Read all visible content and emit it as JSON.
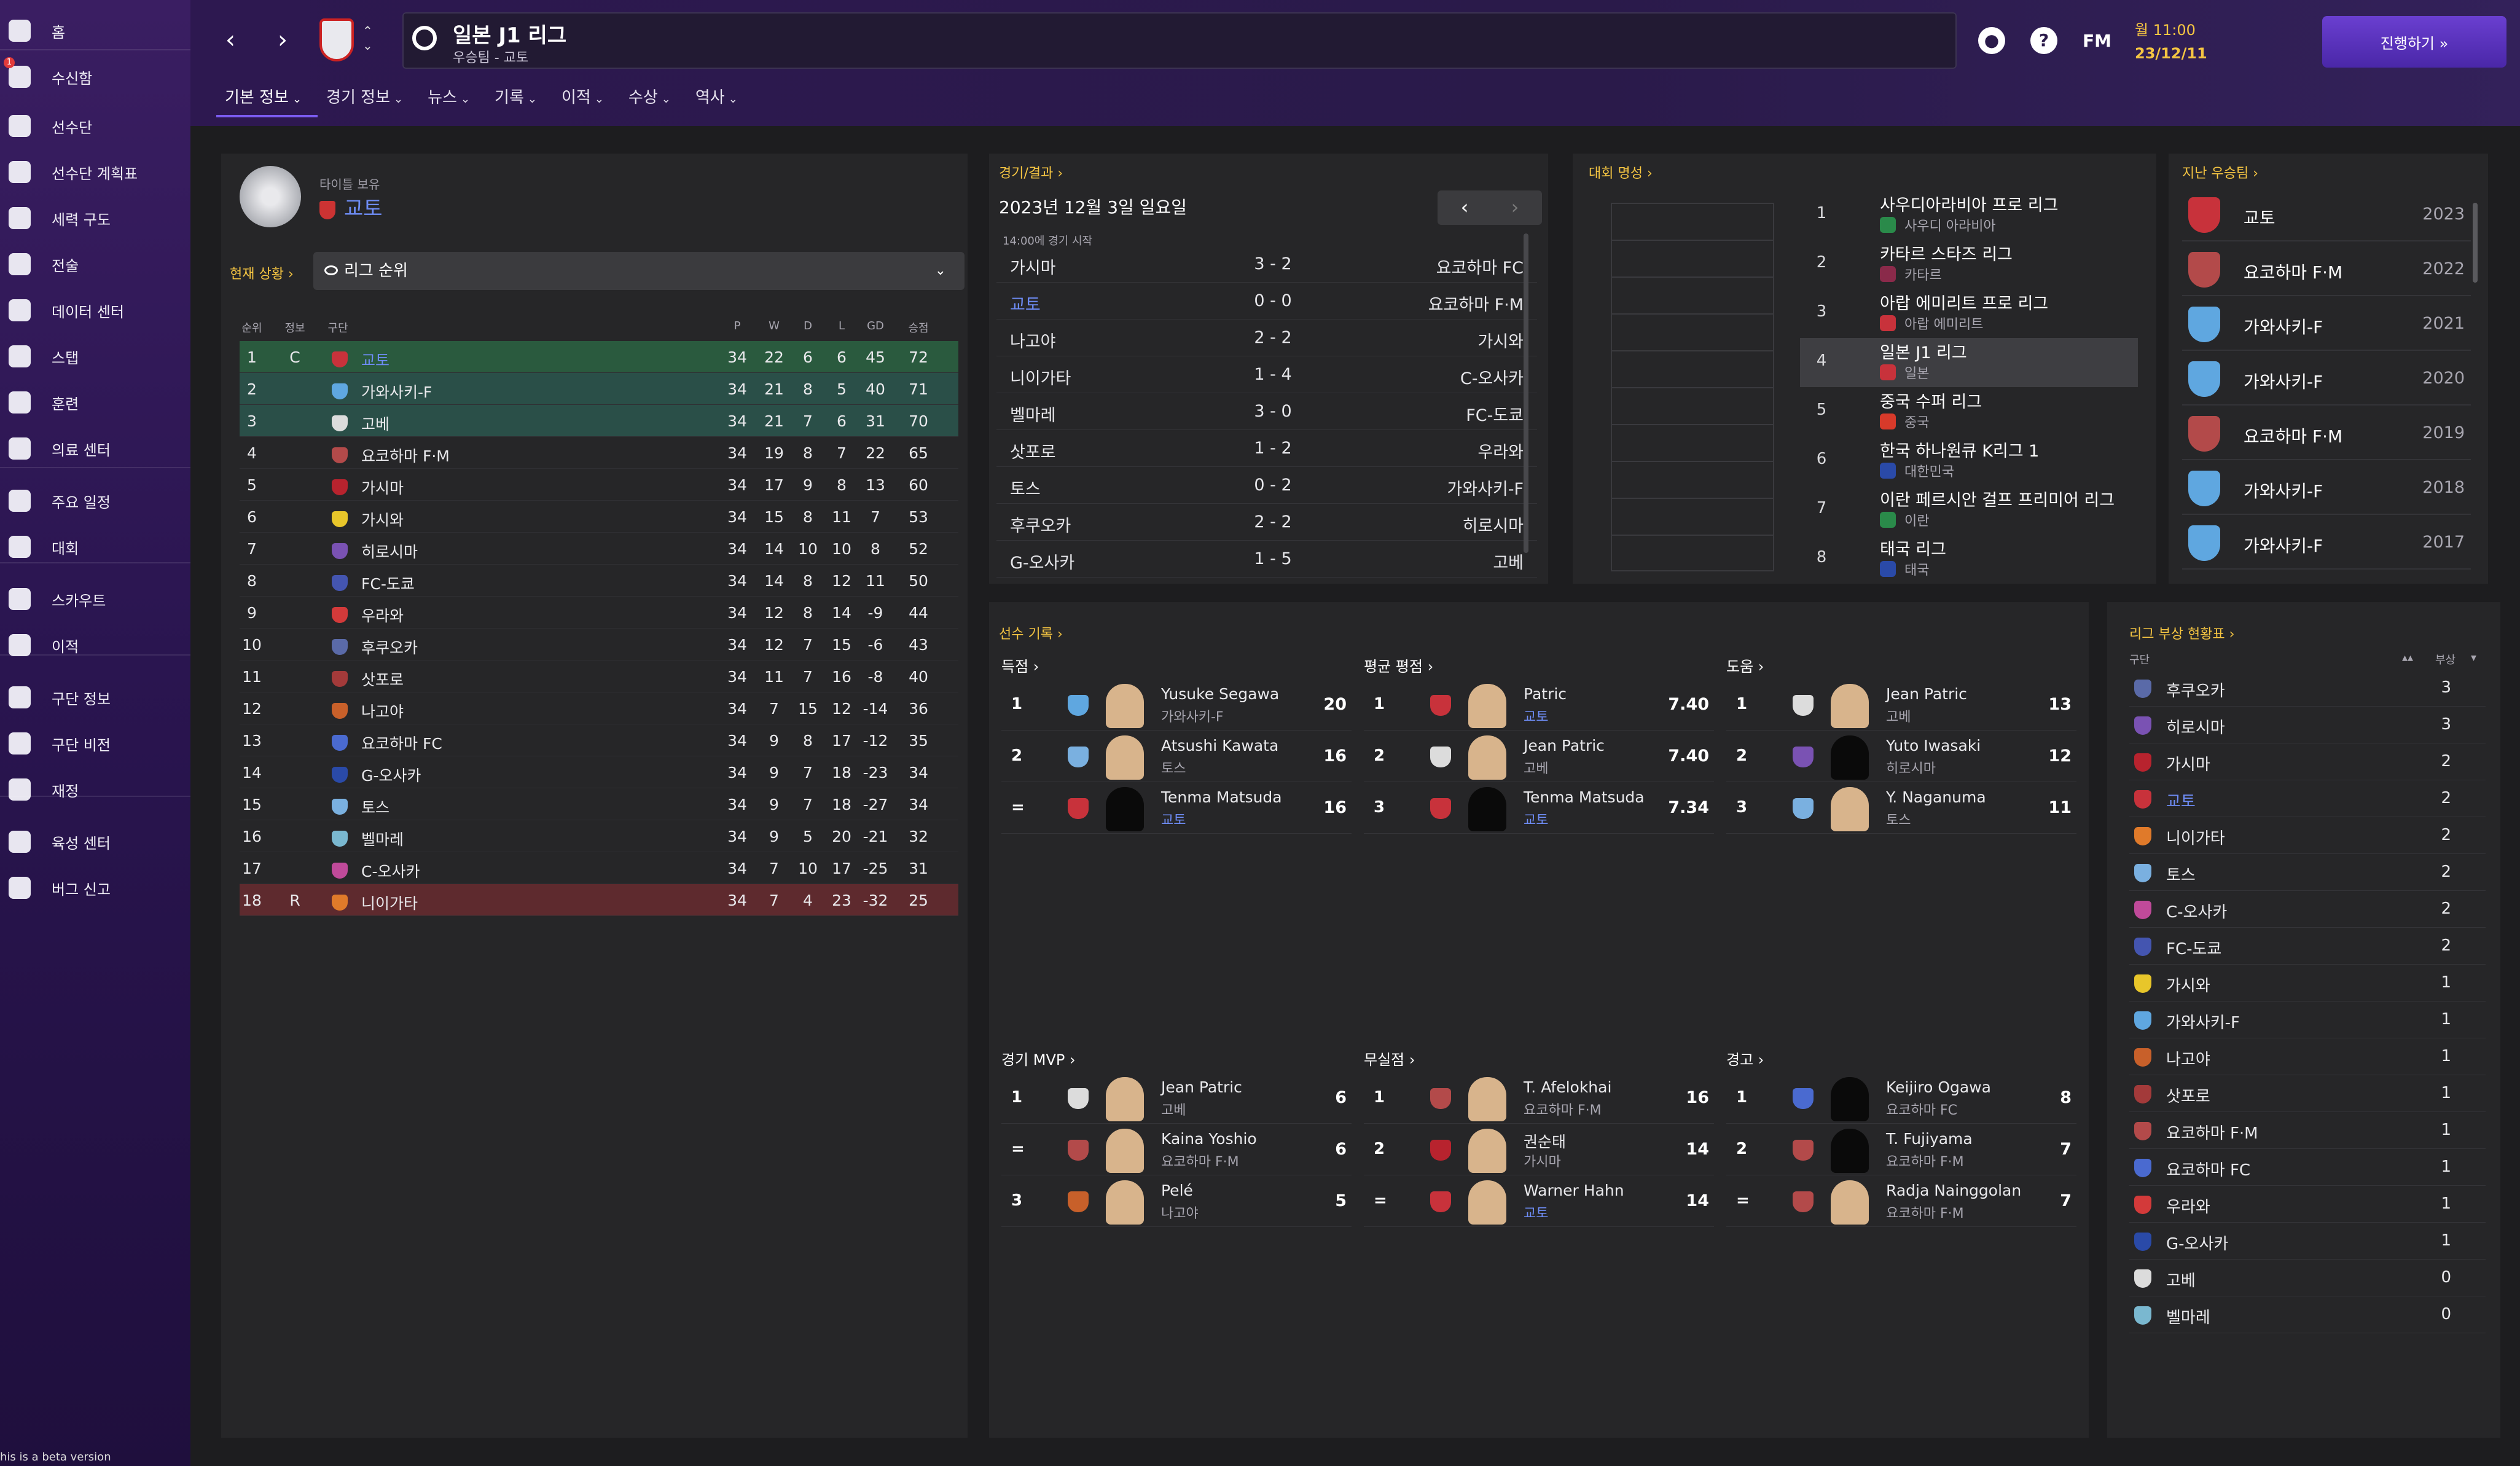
{
  "sidebar": {
    "items": [
      {
        "label": "홈",
        "icon": "home-icon"
      },
      {
        "label": "수신함",
        "icon": "inbox-icon",
        "badge": "1"
      },
      {
        "label": "선수단",
        "icon": "squad-icon"
      },
      {
        "label": "선수단 계획표",
        "icon": "squad-planner-icon"
      },
      {
        "label": "세력 구도",
        "icon": "dynamics-icon"
      },
      {
        "label": "전술",
        "icon": "tactics-icon"
      },
      {
        "label": "데이터 센터",
        "icon": "data-hub-icon"
      },
      {
        "label": "스탭",
        "icon": "staff-icon"
      },
      {
        "label": "훈련",
        "icon": "training-icon"
      },
      {
        "label": "의료 센터",
        "icon": "medical-icon"
      },
      {
        "label": "주요 일정",
        "icon": "calendar-icon"
      },
      {
        "label": "대회",
        "icon": "trophy-icon"
      },
      {
        "label": "스카우트",
        "icon": "scouting-icon"
      },
      {
        "label": "이적",
        "icon": "transfers-icon"
      },
      {
        "label": "구단 정보",
        "icon": "club-info-icon"
      },
      {
        "label": "구단 비전",
        "icon": "club-vision-icon"
      },
      {
        "label": "재정",
        "icon": "finances-icon"
      },
      {
        "label": "육성 센터",
        "icon": "development-icon"
      },
      {
        "label": "버그 신고",
        "icon": "bug-report-icon"
      }
    ],
    "beta_note": "his is a beta version"
  },
  "header": {
    "title": "일본 J1 리그",
    "subtitle": "우승팀 - 교토",
    "fm_label": "FM",
    "help_label": "?",
    "date_line1": "월 11:00",
    "date_line2": "23/12/11",
    "continue_label": "진행하기 »",
    "tabs": [
      {
        "label": "기본 정보"
      },
      {
        "label": "경기 정보"
      },
      {
        "label": "뉴스"
      },
      {
        "label": "기록"
      },
      {
        "label": "이적"
      },
      {
        "label": "수상"
      },
      {
        "label": "역사"
      }
    ]
  },
  "league_table": {
    "title_holder_label": "타이틀 보유",
    "title_holder_club": "교토",
    "status_label": "현재 상황 ›",
    "status_select": "리그 순위",
    "headers": {
      "pos": "순위",
      "info": "정보",
      "club": "구단",
      "p": "P",
      "w": "W",
      "d": "D",
      "l": "L",
      "gd": "GD",
      "pts": "승점"
    },
    "rows": [
      {
        "pos": "1",
        "info": "C",
        "club": "교토",
        "p": "34",
        "w": "22",
        "d": "6",
        "l": "6",
        "gd": "45",
        "pts": "72",
        "color": "#c8323b"
      },
      {
        "pos": "2",
        "info": "",
        "club": "가와사키-F",
        "p": "34",
        "w": "21",
        "d": "8",
        "l": "5",
        "gd": "40",
        "pts": "71",
        "color": "#5fa7e0"
      },
      {
        "pos": "3",
        "info": "",
        "club": "고베",
        "p": "34",
        "w": "21",
        "d": "7",
        "l": "6",
        "gd": "31",
        "pts": "70",
        "color": "#dcdcdc"
      },
      {
        "pos": "4",
        "info": "",
        "club": "요코하마 F·M",
        "p": "34",
        "w": "19",
        "d": "8",
        "l": "7",
        "gd": "22",
        "pts": "65",
        "color": "#b34a4a"
      },
      {
        "pos": "5",
        "info": "",
        "club": "가시마",
        "p": "34",
        "w": "17",
        "d": "9",
        "l": "8",
        "gd": "13",
        "pts": "60",
        "color": "#b8232e"
      },
      {
        "pos": "6",
        "info": "",
        "club": "가시와",
        "p": "34",
        "w": "15",
        "d": "8",
        "l": "11",
        "gd": "7",
        "pts": "53",
        "color": "#e8c62a"
      },
      {
        "pos": "7",
        "info": "",
        "club": "히로시마",
        "p": "34",
        "w": "14",
        "d": "10",
        "l": "10",
        "gd": "8",
        "pts": "52",
        "color": "#7a52b3"
      },
      {
        "pos": "8",
        "info": "",
        "club": "FC-도쿄",
        "p": "34",
        "w": "14",
        "d": "8",
        "l": "12",
        "gd": "11",
        "pts": "50",
        "color": "#4455b0"
      },
      {
        "pos": "9",
        "info": "",
        "club": "우라와",
        "p": "34",
        "w": "12",
        "d": "8",
        "l": "14",
        "gd": "-9",
        "pts": "44",
        "color": "#d33a3a"
      },
      {
        "pos": "10",
        "info": "",
        "club": "후쿠오카",
        "p": "34",
        "w": "12",
        "d": "7",
        "l": "15",
        "gd": "-6",
        "pts": "43",
        "color": "#5a6aa8"
      },
      {
        "pos": "11",
        "info": "",
        "club": "삿포로",
        "p": "34",
        "w": "11",
        "d": "7",
        "l": "16",
        "gd": "-8",
        "pts": "40",
        "color": "#a33a3a"
      },
      {
        "pos": "12",
        "info": "",
        "club": "나고야",
        "p": "34",
        "w": "7",
        "d": "15",
        "l": "12",
        "gd": "-14",
        "pts": "36",
        "color": "#c8602a"
      },
      {
        "pos": "13",
        "info": "",
        "club": "요코하마 FC",
        "p": "34",
        "w": "9",
        "d": "8",
        "l": "17",
        "gd": "-12",
        "pts": "35",
        "color": "#4a6ad0"
      },
      {
        "pos": "14",
        "info": "",
        "club": "G-오사카",
        "p": "34",
        "w": "9",
        "d": "7",
        "l": "18",
        "gd": "-23",
        "pts": "34",
        "color": "#2a4aa8"
      },
      {
        "pos": "15",
        "info": "",
        "club": "토스",
        "p": "34",
        "w": "9",
        "d": "7",
        "l": "18",
        "gd": "-27",
        "pts": "34",
        "color": "#7ab0e0"
      },
      {
        "pos": "16",
        "info": "",
        "club": "벨마레",
        "p": "34",
        "w": "9",
        "d": "5",
        "l": "20",
        "gd": "-21",
        "pts": "32",
        "color": "#7ab8d0"
      },
      {
        "pos": "17",
        "info": "",
        "club": "C-오사카",
        "p": "34",
        "w": "7",
        "d": "10",
        "l": "17",
        "gd": "-25",
        "pts": "31",
        "color": "#c04a9a"
      },
      {
        "pos": "18",
        "info": "R",
        "club": "니이가타",
        "p": "34",
        "w": "7",
        "d": "4",
        "l": "23",
        "gd": "-32",
        "pts": "25",
        "color": "#e07a2a"
      }
    ]
  },
  "fixtures": {
    "title": "경기/결과 ›",
    "date": "2023년 12월 3일 일요일",
    "kickoff": "14:00에 경기 시작",
    "prev": "‹",
    "next": "›",
    "rows": [
      {
        "home": "가시마",
        "score": "3 - 2",
        "away": "요코하마 FC"
      },
      {
        "home": "교토",
        "score": "0 - 0",
        "away": "요코하마 F·M",
        "home_link": true
      },
      {
        "home": "나고야",
        "score": "2 - 2",
        "away": "가시와"
      },
      {
        "home": "니이가타",
        "score": "1 - 4",
        "away": "C-오사카"
      },
      {
        "home": "벨마레",
        "score": "3 - 0",
        "away": "FC-도쿄"
      },
      {
        "home": "삿포로",
        "score": "1 - 2",
        "away": "우라와"
      },
      {
        "home": "토스",
        "score": "0 - 2",
        "away": "가와사키-F"
      },
      {
        "home": "후쿠오카",
        "score": "2 - 2",
        "away": "히로시마"
      },
      {
        "home": "G-오사카",
        "score": "1 - 5",
        "away": "고베"
      }
    ]
  },
  "reputation": {
    "title": "대회 명성 ›",
    "rows": [
      {
        "rank": "1",
        "name": "사우디아라비아 프로 리그",
        "country": "사우디 아라비아",
        "color": "#2a8a4a"
      },
      {
        "rank": "2",
        "name": "카타르 스타즈 리그",
        "country": "카타르",
        "color": "#8a2a4a"
      },
      {
        "rank": "3",
        "name": "아랍 에미리트 프로 리그",
        "country": "아랍 에미리트",
        "color": "#c8323b"
      },
      {
        "rank": "4",
        "name": "일본 J1 리그",
        "country": "일본",
        "color": "#c8323b",
        "selected": true
      },
      {
        "rank": "5",
        "name": "중국 수퍼 리그",
        "country": "중국",
        "color": "#d83a2a"
      },
      {
        "rank": "6",
        "name": "한국 하나원큐 K리그 1",
        "country": "대한민국",
        "color": "#2a4aa8"
      },
      {
        "rank": "7",
        "name": "이란 페르시안 걸프 프리미어 리그",
        "country": "이란",
        "color": "#2a8a4a"
      },
      {
        "rank": "8",
        "name": "태국 리그",
        "country": "태국",
        "color": "#2a4aa8"
      }
    ]
  },
  "past_winners": {
    "title": "지난 우승팀 ›",
    "rows": [
      {
        "club": "교토",
        "year": "2023",
        "color": "#c8323b"
      },
      {
        "club": "요코하마 F·M",
        "year": "2022",
        "color": "#b34a4a"
      },
      {
        "club": "가와사키-F",
        "year": "2021",
        "color": "#5fa7e0"
      },
      {
        "club": "가와사키-F",
        "year": "2020",
        "color": "#5fa7e0"
      },
      {
        "club": "요코하마 F·M",
        "year": "2019",
        "color": "#b34a4a"
      },
      {
        "club": "가와사키-F",
        "year": "2018",
        "color": "#5fa7e0"
      },
      {
        "club": "가와사키-F",
        "year": "2017",
        "color": "#5fa7e0"
      }
    ]
  },
  "player_stats": {
    "title": "선수 기록 ›",
    "goals": {
      "title": "득점   ›",
      "rows": [
        {
          "rank": "1",
          "name": "Yusuke Segawa",
          "club": "가와사키-F",
          "value": "20",
          "crest": "#5fa7e0",
          "sil": false
        },
        {
          "rank": "2",
          "name": "Atsushi Kawata",
          "club": "토스",
          "value": "16",
          "crest": "#7ab0e0",
          "sil": false
        },
        {
          "rank": "=",
          "name": "Tenma Matsuda",
          "club": "교토",
          "value": "16",
          "crest": "#c8323b",
          "sil": true,
          "link": true
        }
      ]
    },
    "rating": {
      "title": "평균 평점 ›",
      "rows": [
        {
          "rank": "1",
          "name": "Patric",
          "club": "교토",
          "value": "7.40",
          "crest": "#c8323b",
          "sil": false,
          "link": true
        },
        {
          "rank": "2",
          "name": "Jean Patric",
          "club": "고베",
          "value": "7.40",
          "crest": "#dcdcdc",
          "sil": false
        },
        {
          "rank": "3",
          "name": "Tenma Matsuda",
          "club": "교토",
          "value": "7.34",
          "crest": "#c8323b",
          "sil": true,
          "link": true
        }
      ]
    },
    "assists": {
      "title": "도움   ›",
      "rows": [
        {
          "rank": "1",
          "name": "Jean Patric",
          "club": "고베",
          "value": "13",
          "crest": "#dcdcdc",
          "sil": false
        },
        {
          "rank": "2",
          "name": "Yuto Iwasaki",
          "club": "히로시마",
          "value": "12",
          "crest": "#7a52b3",
          "sil": true
        },
        {
          "rank": "3",
          "name": "Y. Naganuma",
          "club": "토스",
          "value": "11",
          "crest": "#7ab0e0",
          "sil": false
        }
      ]
    },
    "mvp": {
      "title": "경기 MVP ›",
      "rows": [
        {
          "rank": "1",
          "name": "Jean Patric",
          "club": "고베",
          "value": "6",
          "crest": "#dcdcdc",
          "sil": false
        },
        {
          "rank": "=",
          "name": "Kaina Yoshio",
          "club": "요코하마 F·M",
          "value": "6",
          "crest": "#b34a4a",
          "sil": false
        },
        {
          "rank": "3",
          "name": "Pelé",
          "club": "나고야",
          "value": "5",
          "crest": "#c8602a",
          "sil": false
        }
      ]
    },
    "clean_sheets": {
      "title": "무실점 ›",
      "rows": [
        {
          "rank": "1",
          "name": "T. Afelokhai",
          "club": "요코하마 F·M",
          "value": "16",
          "crest": "#b34a4a",
          "sil": false
        },
        {
          "rank": "2",
          "name": "권순태",
          "club": "가시마",
          "value": "14",
          "crest": "#b8232e",
          "sil": false
        },
        {
          "rank": "=",
          "name": "Warner Hahn",
          "club": "교토",
          "value": "14",
          "crest": "#c8323b",
          "sil": false,
          "link": true
        }
      ]
    },
    "cards": {
      "title": "경고   ›",
      "rows": [
        {
          "rank": "1",
          "name": "Keijiro Ogawa",
          "club": "요코하마 FC",
          "value": "8",
          "crest": "#4a6ad0",
          "sil": true
        },
        {
          "rank": "2",
          "name": "T. Fujiyama",
          "club": "요코하마 F·M",
          "value": "7",
          "crest": "#b34a4a",
          "sil": true
        },
        {
          "rank": "=",
          "name": "Radja Nainggolan",
          "club": "요코하마 F·M",
          "value": "7",
          "crest": "#b34a4a",
          "sil": false
        }
      ]
    }
  },
  "injuries": {
    "title": "리그 부상 현황표 ›",
    "col_club": "구단",
    "col_count": "부상",
    "rows": [
      {
        "club": "후쿠오카",
        "value": "3",
        "color": "#5a6aa8"
      },
      {
        "club": "히로시마",
        "value": "3",
        "color": "#7a52b3"
      },
      {
        "club": "가시마",
        "value": "2",
        "color": "#b8232e"
      },
      {
        "club": "교토",
        "value": "2",
        "color": "#c8323b",
        "link": true
      },
      {
        "club": "니이가타",
        "value": "2",
        "color": "#e07a2a"
      },
      {
        "club": "토스",
        "value": "2",
        "color": "#7ab0e0"
      },
      {
        "club": "C-오사카",
        "value": "2",
        "color": "#c04a9a"
      },
      {
        "club": "FC-도쿄",
        "value": "2",
        "color": "#4455b0"
      },
      {
        "club": "가시와",
        "value": "1",
        "color": "#e8c62a"
      },
      {
        "club": "가와사키-F",
        "value": "1",
        "color": "#5fa7e0"
      },
      {
        "club": "나고야",
        "value": "1",
        "color": "#c8602a"
      },
      {
        "club": "삿포로",
        "value": "1",
        "color": "#a33a3a"
      },
      {
        "club": "요코하마 F·M",
        "value": "1",
        "color": "#b34a4a"
      },
      {
        "club": "요코하마 FC",
        "value": "1",
        "color": "#4a6ad0"
      },
      {
        "club": "우라와",
        "value": "1",
        "color": "#d33a3a"
      },
      {
        "club": "G-오사카",
        "value": "1",
        "color": "#2a4aa8"
      },
      {
        "club": "고베",
        "value": "0",
        "color": "#dcdcdc"
      },
      {
        "club": "벨마레",
        "value": "0",
        "color": "#7ab8d0"
      }
    ]
  }
}
